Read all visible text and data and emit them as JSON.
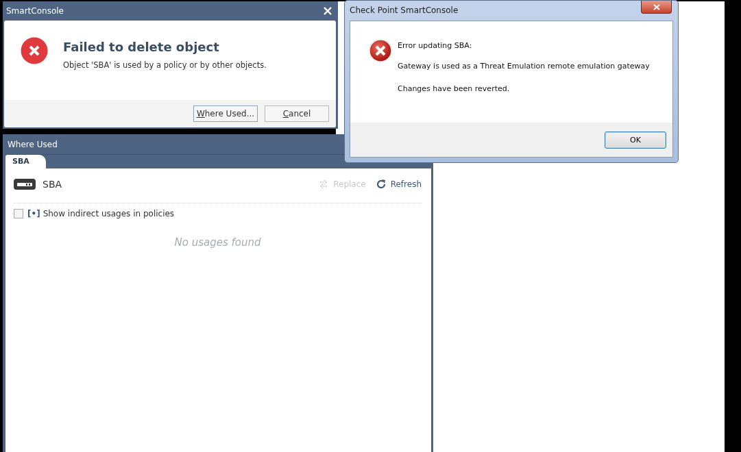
{
  "smartconsole_dialog": {
    "title": "SmartConsole",
    "heading": "Failed to delete object",
    "message": "Object 'SBA' is used by a policy or by other objects.",
    "buttons": [
      {
        "label": "Where Used...",
        "first_letter_underlined": true,
        "default": true
      },
      {
        "label": "Cancel",
        "first_letter_underlined": true,
        "default": false
      }
    ]
  },
  "where_used": {
    "title": "Where Used",
    "tabs": [
      {
        "label": "SBA",
        "selected": true
      }
    ],
    "object_name": "SBA",
    "actions": [
      {
        "kind": "replace",
        "label": "Replace",
        "disabled": true
      },
      {
        "kind": "refresh",
        "label": "Refresh",
        "disabled": false
      }
    ],
    "option": {
      "marker": "[•]",
      "label": "Show indirect usages in policies",
      "checked": false
    },
    "empty_message": "No usages found"
  },
  "system_dialog": {
    "title": "Check Point SmartConsole",
    "lines": [
      "Error updating SBA:",
      "Gateway is used as a Threat Emulation remote emulation gateway",
      "Changes have been reverted."
    ],
    "buttons": [
      {
        "label": "OK",
        "default": true
      }
    ]
  }
}
